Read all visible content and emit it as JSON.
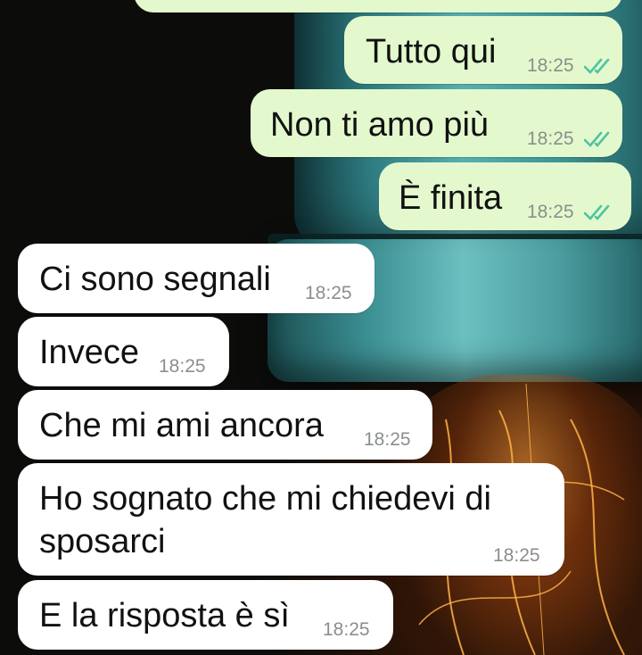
{
  "messages": [
    {
      "id": "m1",
      "dir": "out",
      "text": "Tutto qui",
      "time": "18:25",
      "status": "read"
    },
    {
      "id": "m2",
      "dir": "out",
      "text": "Non ti amo più",
      "time": "18:25",
      "status": "read"
    },
    {
      "id": "m3",
      "dir": "out",
      "text": "È finita",
      "time": "18:25",
      "status": "read"
    },
    {
      "id": "m4",
      "dir": "in",
      "text": "Ci sono segnali",
      "time": "18:25"
    },
    {
      "id": "m5",
      "dir": "in",
      "text": "Invece",
      "time": "18:25"
    },
    {
      "id": "m6",
      "dir": "in",
      "text": "Che mi ami ancora",
      "time": "18:25"
    },
    {
      "id": "m7",
      "dir": "in",
      "lines": [
        "Ho sognato che mi chiedevi di",
        "sposarci"
      ],
      "time": "18:25"
    },
    {
      "id": "m8",
      "dir": "in",
      "text": "E la risposta è sì",
      "time": "18:25"
    }
  ],
  "colors": {
    "outgoing_bubble": "#e3f9cd",
    "incoming_bubble": "#ffffff",
    "read_ticks": "#4fc3a1",
    "timestamp": "#8a8f8c"
  },
  "icons": {
    "read_status": "double-check-icon"
  }
}
